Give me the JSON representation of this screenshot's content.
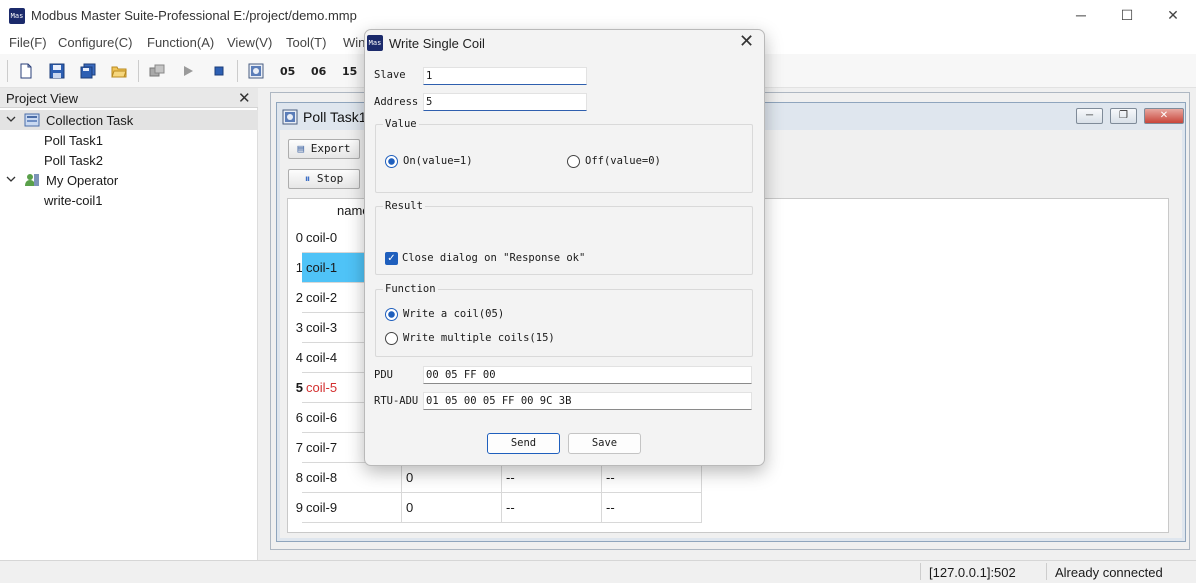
{
  "app": {
    "logo_text": "Mas",
    "title": "Modbus Master Suite-Professional E:/project/demo.mmp",
    "window_controls": {
      "minimize": "─",
      "maximize": "☐",
      "close": "✕"
    }
  },
  "menu": [
    "File(F)",
    "Configure(C)",
    "Function(A)",
    "View(V)",
    "Tool(T)",
    "Win"
  ],
  "toolbar": {
    "icons": [
      "new-file-icon",
      "save-icon",
      "save-all-icon",
      "open-folder-icon",
      "connect-icon",
      "run-icon",
      "stop-icon",
      "task-icon"
    ],
    "function_codes": [
      "05",
      "06",
      "15"
    ]
  },
  "project_view": {
    "title": "Project View",
    "close": "✕",
    "tree": [
      {
        "label": "Collection Task",
        "level": 0,
        "expanded": true,
        "selected": true
      },
      {
        "label": "Poll Task1",
        "level": 1
      },
      {
        "label": "Poll Task2",
        "level": 1
      },
      {
        "label": "My Operator",
        "level": 0,
        "expanded": true
      },
      {
        "label": "write-coil1",
        "level": 1
      }
    ]
  },
  "poll_window": {
    "title": "Poll Task1",
    "export_label": "Export",
    "stop_label": "Stop",
    "header_name": "name",
    "rows": [
      {
        "num": "0",
        "name": "coil-0"
      },
      {
        "num": "1",
        "name": "coil-1",
        "selected": true
      },
      {
        "num": "2",
        "name": "coil-2"
      },
      {
        "num": "3",
        "name": "coil-3"
      },
      {
        "num": "4",
        "name": "coil-4"
      },
      {
        "num": "5",
        "name": "coil-5",
        "highlight": true
      },
      {
        "num": "6",
        "name": "coil-6"
      },
      {
        "num": "7",
        "name": "coil-7"
      },
      {
        "num": "8",
        "name": "coil-8",
        "value": "0",
        "c3": "--",
        "c4": "--"
      },
      {
        "num": "9",
        "name": "coil-9",
        "value": "0",
        "c3": "--",
        "c4": "--"
      }
    ]
  },
  "dialog": {
    "title": "Write Single Coil",
    "close": "✕",
    "slave_label": "Slave",
    "slave_value": "1",
    "address_label": "Address",
    "address_value": "5",
    "value_group": "Value",
    "on_label": "On(value=1)",
    "off_label": "Off(value=0)",
    "result_group": "Result",
    "close_on_ok_label": "Close dialog on \"Response ok\"",
    "function_group": "Function",
    "write_coil_label": "Write a coil(05)",
    "write_multi_label": "Write multiple coils(15)",
    "pdu_label": "PDU",
    "pdu_value": "00 05 FF 00",
    "rtu_label": "RTU-ADU",
    "rtu_value": "01 05 00 05 FF 00 9C 3B",
    "send_label": "Send",
    "save_label": "Save"
  },
  "status": {
    "address": "[127.0.0.1]:502",
    "connection": "Already connected"
  },
  "colors": {
    "accent": "#1f5fbd",
    "selected_row": "#4fc3f7",
    "highlight_text": "#d32f2f"
  }
}
